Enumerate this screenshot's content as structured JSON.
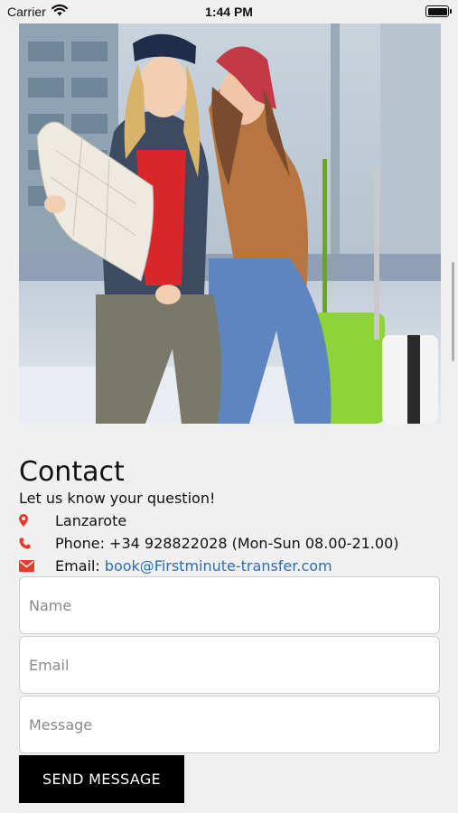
{
  "status_bar": {
    "carrier": "Carrier",
    "time": "1:44 PM"
  },
  "hero": {
    "icon": "hero-photo"
  },
  "contact": {
    "title": "Contact",
    "subtitle": "Let us know your question!",
    "location": "Lanzarote",
    "phone": "Phone: +34 928822028 (Mon-Sun 08.00-21.00)",
    "email_label": "Email: ",
    "email": "book@Firstminute-transfer.com",
    "accent_color": "#e8392f",
    "link_color": "#2a6fb5"
  },
  "form": {
    "name_placeholder": "Name",
    "email_placeholder": "Email",
    "message_placeholder": "Message",
    "send_label": "SEND MESSAGE"
  }
}
